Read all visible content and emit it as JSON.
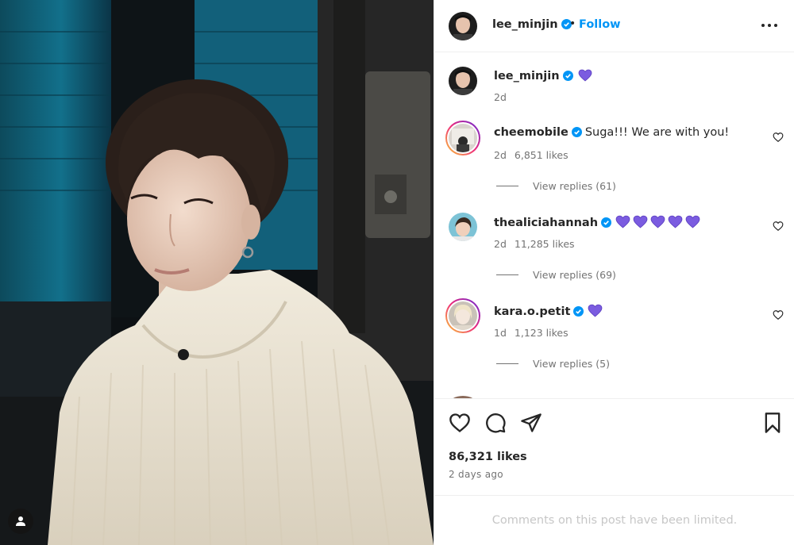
{
  "post": {
    "username": "lee_minjin",
    "follow_label": "Follow",
    "separator": "•",
    "caption_time": "2d",
    "likes": "86,321 likes",
    "posted_ago": "2 days ago",
    "comments_limited": "Comments on this post have been limited."
  },
  "comments": [
    {
      "username": "cheemobile",
      "text": "Suga!!! We are with you!",
      "time": "2d",
      "likes": "6,851 likes",
      "replies": "View replies (61)",
      "hearts": 0
    },
    {
      "username": "thealiciahannah",
      "text": "",
      "time": "2d",
      "likes": "11,285 likes",
      "replies": "View replies (69)",
      "hearts": 5
    },
    {
      "username": "kara.o.petit",
      "text": "",
      "time": "1d",
      "likes": "1,123 likes",
      "replies": "View replies (5)",
      "hearts": 1
    }
  ],
  "colors": {
    "accent_blue": "#0095f6",
    "verified_blue": "#0095f6",
    "purple_heart": "#7b5ce0",
    "muted_text": "#737373",
    "limited_text": "#c7c7c7"
  },
  "icons": [
    "verified-badge-icon",
    "purple-heart-icon",
    "more-options-icon",
    "heart-icon",
    "comment-icon",
    "share-icon",
    "bookmark-icon",
    "tagged-user-icon"
  ]
}
